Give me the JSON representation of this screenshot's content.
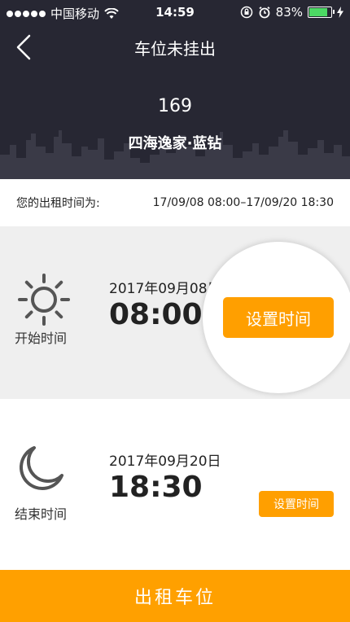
{
  "status_bar": {
    "carrier": "中国移动",
    "time": "14:59",
    "battery": "83%",
    "battery_level": 0.83
  },
  "nav": {
    "title": "车位未挂出"
  },
  "parking": {
    "lot_number": "169",
    "community": "四海逸家·蓝钻"
  },
  "rent_period": {
    "label": "您的出租时间为:",
    "value": "17/09/08  08:00–17/09/20  18:30"
  },
  "start": {
    "label": "开始时间",
    "date": "2017年09月08日",
    "time": "08:00",
    "button": "设置时间"
  },
  "end": {
    "label": "结束时间",
    "date": "2017年09月20日",
    "time": "18:30",
    "button": "设置时间"
  },
  "footer": {
    "button": "出租车位"
  },
  "colors": {
    "accent": "#ff9f00",
    "header_bg": "#272733"
  }
}
